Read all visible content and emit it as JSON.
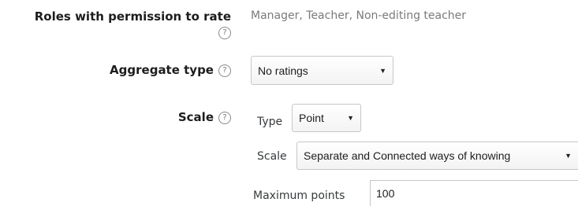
{
  "roles": {
    "label": "Roles with permission to rate",
    "help_icon": "question-circle-icon",
    "value": "Manager, Teacher, Non-editing teacher"
  },
  "aggregate": {
    "label": "Aggregate type",
    "help_icon": "question-circle-icon",
    "selected": "No ratings"
  },
  "scale": {
    "label": "Scale",
    "help_icon": "question-circle-icon",
    "type_label": "Type",
    "type_selected": "Point",
    "scale_label": "Scale",
    "scale_selected": "Separate and Connected ways of knowing",
    "max_points_label": "Maximum points",
    "max_points_value": "100"
  },
  "glyphs": {
    "help": "?",
    "caret": "▼"
  }
}
